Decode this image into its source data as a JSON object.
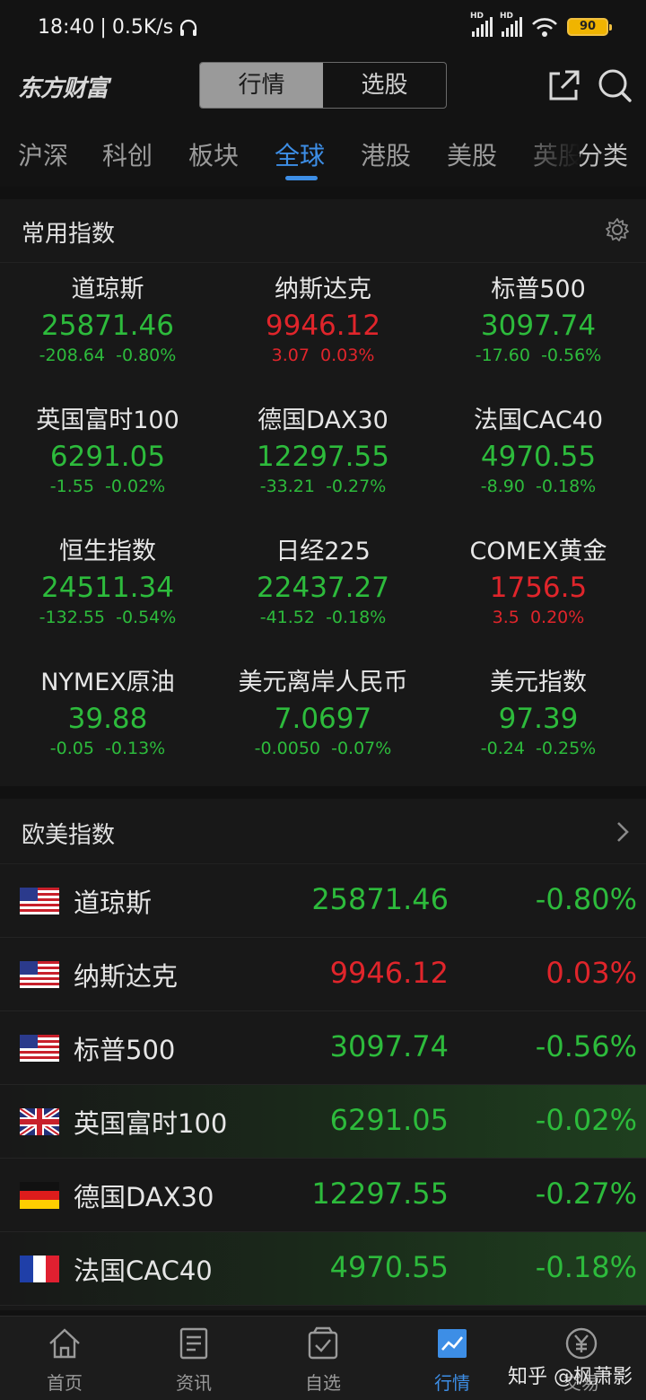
{
  "status_bar": {
    "time": "18:40",
    "speed": "0.5K/s",
    "battery": "90",
    "hd1": "HD",
    "hd2": "HD"
  },
  "header": {
    "logo": "东方财富",
    "seg_market": "行情",
    "seg_stock": "选股"
  },
  "tabs": [
    "沪深",
    "科创",
    "板块",
    "全球",
    "港股",
    "美股",
    "英股",
    "分类"
  ],
  "common": {
    "title": "常用指数",
    "items": [
      {
        "name": "道琼斯",
        "price": "25871.46",
        "change": "-208.64",
        "pct": "-0.80%",
        "dir": "down"
      },
      {
        "name": "纳斯达克",
        "price": "9946.12",
        "change": "3.07",
        "pct": "0.03%",
        "dir": "up"
      },
      {
        "name": "标普500",
        "price": "3097.74",
        "change": "-17.60",
        "pct": "-0.56%",
        "dir": "down"
      },
      {
        "name": "英国富时100",
        "price": "6291.05",
        "change": "-1.55",
        "pct": "-0.02%",
        "dir": "down"
      },
      {
        "name": "德国DAX30",
        "price": "12297.55",
        "change": "-33.21",
        "pct": "-0.27%",
        "dir": "down"
      },
      {
        "name": "法国CAC40",
        "price": "4970.55",
        "change": "-8.90",
        "pct": "-0.18%",
        "dir": "down"
      },
      {
        "name": "恒生指数",
        "price": "24511.34",
        "change": "-132.55",
        "pct": "-0.54%",
        "dir": "down"
      },
      {
        "name": "日经225",
        "price": "22437.27",
        "change": "-41.52",
        "pct": "-0.18%",
        "dir": "down"
      },
      {
        "name": "COMEX黄金",
        "price": "1756.5",
        "change": "3.5",
        "pct": "0.20%",
        "dir": "up"
      },
      {
        "name": "NYMEX原油",
        "price": "39.88",
        "change": "-0.05",
        "pct": "-0.13%",
        "dir": "down"
      },
      {
        "name": "美元离岸人民币",
        "price": "7.0697",
        "change": "-0.0050",
        "pct": "-0.07%",
        "dir": "down"
      },
      {
        "name": "美元指数",
        "price": "97.39",
        "change": "-0.24",
        "pct": "-0.25%",
        "dir": "down"
      }
    ]
  },
  "western": {
    "title": "欧美指数",
    "rows": [
      {
        "flag": "us",
        "name": "道琼斯",
        "price": "25871.46",
        "pct": "-0.80%",
        "dir": "down",
        "highlight": false
      },
      {
        "flag": "us",
        "name": "纳斯达克",
        "price": "9946.12",
        "pct": "0.03%",
        "dir": "up",
        "highlight": false
      },
      {
        "flag": "us",
        "name": "标普500",
        "price": "3097.74",
        "pct": "-0.56%",
        "dir": "down",
        "highlight": false
      },
      {
        "flag": "uk",
        "name": "英国富时100",
        "price": "6291.05",
        "pct": "-0.02%",
        "dir": "down",
        "highlight": true
      },
      {
        "flag": "de",
        "name": "德国DAX30",
        "price": "12297.55",
        "pct": "-0.27%",
        "dir": "down",
        "highlight": false
      },
      {
        "flag": "fr",
        "name": "法国CAC40",
        "price": "4970.55",
        "pct": "-0.18%",
        "dir": "down",
        "highlight": true
      }
    ]
  },
  "bottom_nav": [
    {
      "label": "首页",
      "icon": "home-icon"
    },
    {
      "label": "资讯",
      "icon": "news-icon"
    },
    {
      "label": "自选",
      "icon": "watchlist-icon"
    },
    {
      "label": "行情",
      "icon": "market-icon"
    },
    {
      "label": "交易",
      "icon": "trade-icon"
    }
  ],
  "watermark": "知乎 @枫萧影",
  "colors": {
    "up": "#e0252b",
    "down": "#2dbb3c",
    "accent": "#3d8ee6"
  }
}
